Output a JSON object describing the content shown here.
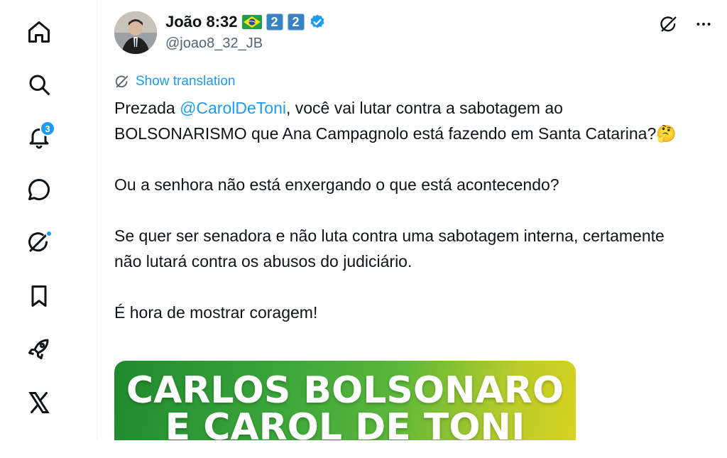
{
  "nav": {
    "items": [
      {
        "name": "home",
        "icon": "home-icon"
      },
      {
        "name": "explore",
        "icon": "search-icon"
      },
      {
        "name": "notifications",
        "icon": "bell-icon",
        "badge": "3"
      },
      {
        "name": "messages",
        "icon": "chat-bubble-icon"
      },
      {
        "name": "grok",
        "icon": "grok-icon",
        "dot": true
      },
      {
        "name": "bookmarks",
        "icon": "bookmark-icon"
      },
      {
        "name": "premium",
        "icon": "rocket-icon"
      },
      {
        "name": "x",
        "icon": "x-logo-icon"
      }
    ]
  },
  "tweet": {
    "author": {
      "display_name": "João 8:32",
      "number_badges": [
        "2",
        "2"
      ],
      "handle": "@joao8_32_JB"
    },
    "show_translation": "Show translation",
    "body": {
      "p1_before": "Prezada ",
      "p1_mention": "@CarolDeToni",
      "p1_after": ", você vai lutar contra a sabotagem ao BOLSONARISMO que Ana Campagnolo está fazendo em Santa Catarina?🤔",
      "p2": "Ou a senhora não está enxergando o que está acontecendo?",
      "p3": "Se quer ser senadora e não luta contra uma sabotagem interna, certamente não lutará contra os abusos do judiciário.",
      "p4": "É hora de mostrar coragem!"
    },
    "media": {
      "line1": "CARLOS BOLSONARO",
      "line2": "E CAROL DE TONI"
    }
  },
  "colors": {
    "accent": "#1d9bf0",
    "text": "#0f1419",
    "secondary": "#536471",
    "media_green": "#3aa53a",
    "media_yellow": "#d8d21e"
  }
}
